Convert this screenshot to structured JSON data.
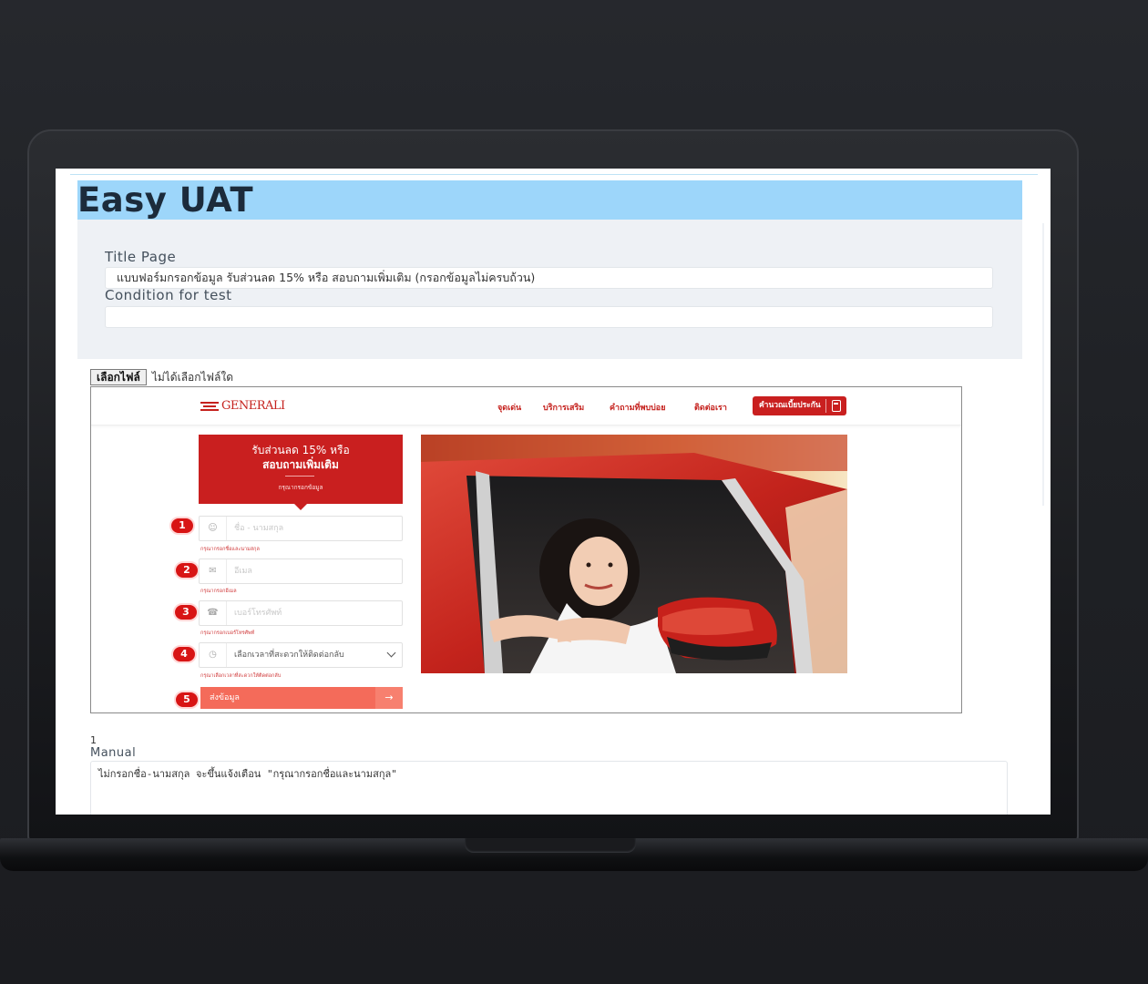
{
  "app": {
    "title": "Easy UAT"
  },
  "form": {
    "title_page_label": "Title Page",
    "title_page_value": "แบบฟอร์มกรอกข้อมูล รับส่วนลด 15% หรือ สอบถามเพิ่มเติม (กรอกข้อมูลไม่ครบถ้วน)",
    "condition_label": "Condition for test",
    "condition_value": ""
  },
  "file_input": {
    "button_label": "เลือกไฟล์",
    "status": "ไม่ได้เลือกไฟล์ใด"
  },
  "preview": {
    "logo": "GENERALI",
    "nav": [
      "จุดเด่น",
      "บริการเสริม",
      "คำถามที่พบบ่อย",
      "ติดต่อเรา"
    ],
    "cta": "คำนวณเบี้ยประกัน",
    "banner": {
      "line1": "รับส่วนลด 15% หรือ",
      "line2": "สอบถามเพิ่มเติม",
      "line3": "กรุณากรอกข้อมูล"
    },
    "fields": [
      {
        "badge": "1",
        "icon": "user-icon",
        "placeholder": "ชื่อ - นามสกุล",
        "hint": "กรุณากรอกชื่อและนามสกุล"
      },
      {
        "badge": "2",
        "icon": "mail-icon",
        "placeholder": "อีเมล",
        "hint": "กรุณากรอกอีเมล"
      },
      {
        "badge": "3",
        "icon": "phone-icon",
        "placeholder": "เบอร์โทรศัพท์",
        "hint": "กรุณากรอกเบอร์โทรศัพท์"
      },
      {
        "badge": "4",
        "icon": "clock-icon",
        "value": "เลือกเวลาที่สะดวกให้ติดต่อกลับ",
        "hint": "กรุณาเลือกเวลาที่สะดวกให้ติดต่อกลับ"
      }
    ],
    "submit": {
      "badge": "5",
      "label": "ส่งข้อมูล",
      "arrow": "→"
    },
    "colors": {
      "brand_red": "#c91f1f",
      "submit": "#f46b5a",
      "badge": "#d81414"
    }
  },
  "manual": {
    "number": "1",
    "label": "Manual",
    "text": "ไม่กรอกชื่อ-นามสกุล จะขึ้นแจ้งเตือน \"กรุณากรอกชื่อและนามสกุล\""
  },
  "colors": {
    "header_bg": "#9dd6fa",
    "panel_bg": "#eef1f5",
    "title_text": "#1c2b3b"
  }
}
